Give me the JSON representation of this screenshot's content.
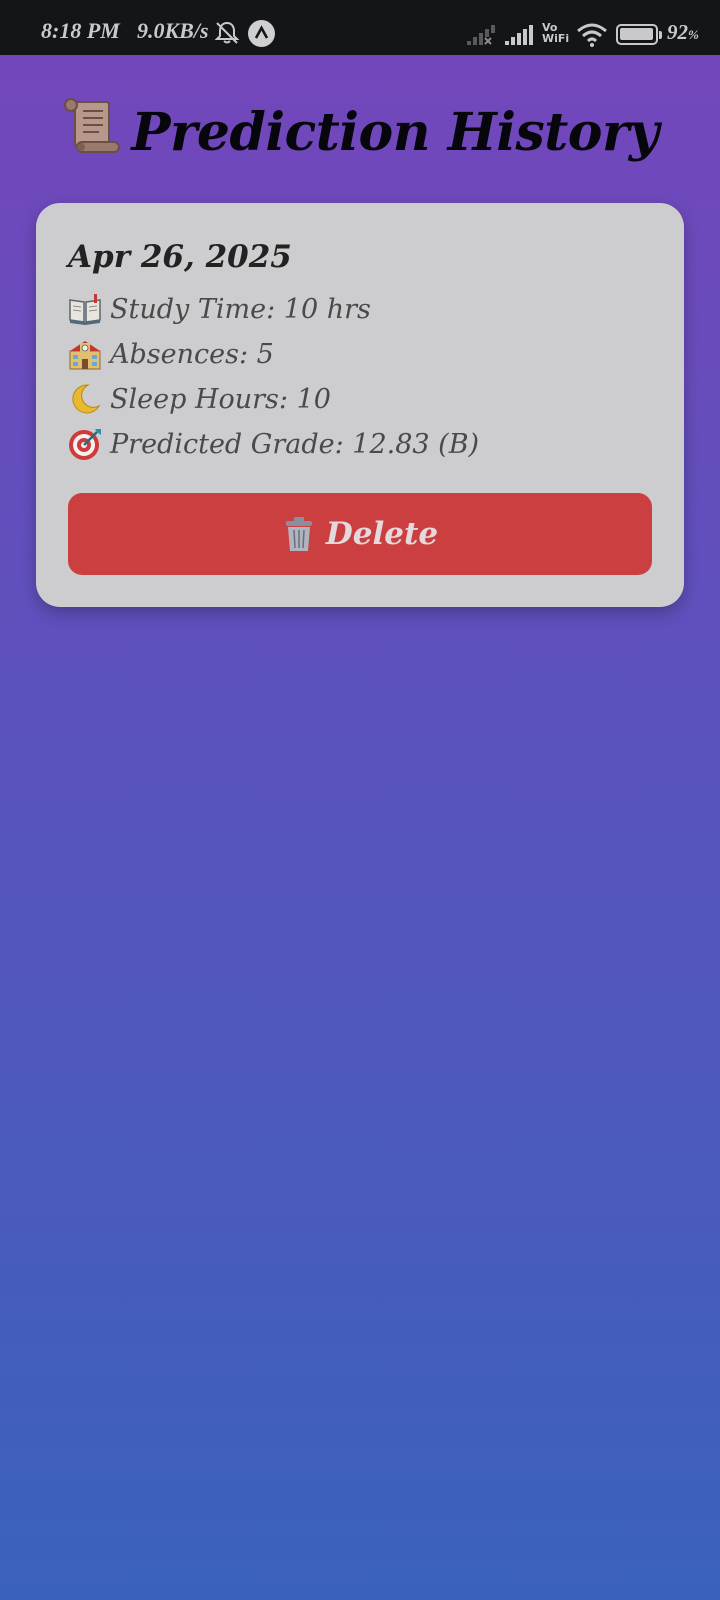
{
  "status_bar": {
    "time": "8:18 PM",
    "speed": "9.0KB/s",
    "vowifi_top": "Vo",
    "vowifi_bottom": "WiFi",
    "battery": "92",
    "battery_unit": "%",
    "battery_level": 0.92,
    "icons": [
      "bell-muted-icon",
      "app-notification-icon",
      "signal-no-service-icon",
      "signal-full-icon",
      "vowifi-icon",
      "wifi-icon",
      "battery-icon"
    ]
  },
  "header": {
    "title": "Prediction History",
    "icon": "scroll-icon"
  },
  "history": [
    {
      "date": "Apr 26, 2025",
      "study_time": "Study Time: 10 hrs",
      "absences": "Absences: 5",
      "sleep_hours": "Sleep Hours: 10",
      "predicted_grade": "Predicted Grade: 12.83 (B)",
      "icons": [
        "book-icon",
        "school-icon",
        "moon-icon",
        "target-icon"
      ],
      "delete_label": "Delete",
      "delete_icon": "trash-icon"
    }
  ],
  "colors": {
    "gradient_top": "#7546bb",
    "gradient_bottom": "#3a62bd",
    "card_bg": "#cdcccf",
    "delete_bg": "#cc3f40"
  }
}
